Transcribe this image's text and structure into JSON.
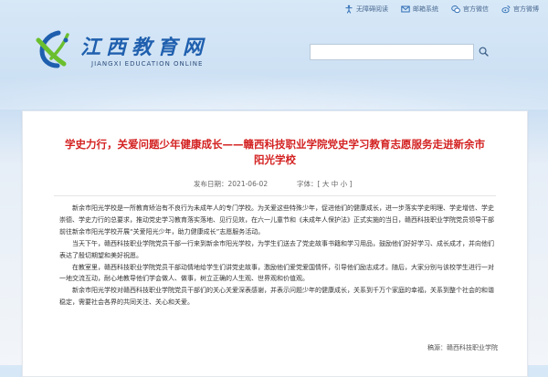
{
  "header": {
    "top_links": [
      {
        "icon": "accessibility-icon",
        "label": "无障碍阅读"
      },
      {
        "icon": "mail-icon",
        "label": "邮箱系统"
      },
      {
        "icon": "wechat-icon",
        "label": "官方微信"
      },
      {
        "icon": "weibo-icon",
        "label": "官方微博"
      }
    ],
    "logo_cn": "江西教育网",
    "logo_en": "JIANGXI EDUCATION ONLINE",
    "search": {
      "value": "",
      "placeholder": "",
      "icon": "search-icon"
    }
  },
  "article": {
    "title_line1": "学史力行，关爱问题少年健康成长——赣西科技职业学院党史学习教育志愿服务走进新余市",
    "title_line2": "阳光学校",
    "meta": {
      "date": "发布日期：2021-06-02",
      "font_label": "字体：",
      "font_open": "[",
      "sizes": [
        "大",
        "中",
        "小"
      ],
      "font_close": "]"
    },
    "paragraphs": [
      "新余市阳光学校是一所教育矫治有不良行为未成年人的专门学校。为关爱这些特殊少年，促进他们的健康成长，进一步落实学史明理、学史增信、学史崇德、学史力行的总要求，推动党史学习教育落实落地、见行见效，在六一儿童节和《未成年人保护法》正式实施的当日，赣西科技职业学院党员领导干部前往新余市阳光学校开展“关爱阳光少年，助力健康成长”志愿服务活动。",
      "当天下午，赣西科技职业学院党员干部一行来到新余市阳光学校，为学生们送去了党史故事书籍和学习用品，鼓励他们好好学习、成长成才，并向他们表达了殷切期望和美好祝愿。",
      "在教室里，赣西科技职业学院党员干部动情地给学生们讲党史故事，激励他们爱党爱国情怀，引导他们励志成才。随后，大家分别与该校学生进行一对一地交流互动，耐心地教导他们学会做人、做事，树立正确的人生观、世界观和价值观。",
      "新余市阳光学校对赣西科技职业学院党员干部们的关心关爱深表感谢，并表示问题少年的健康成长，关系到千万个家庭的幸福，关系到整个社会的和谐稳定，需要社会各界的共同关注、关心和关爱。"
    ],
    "source": "稿源：赣西科技职业学院"
  },
  "colors": {
    "title_red": "#d42222",
    "brand_blue": "#1f5fae",
    "logo_green": "#6bbf2e"
  }
}
